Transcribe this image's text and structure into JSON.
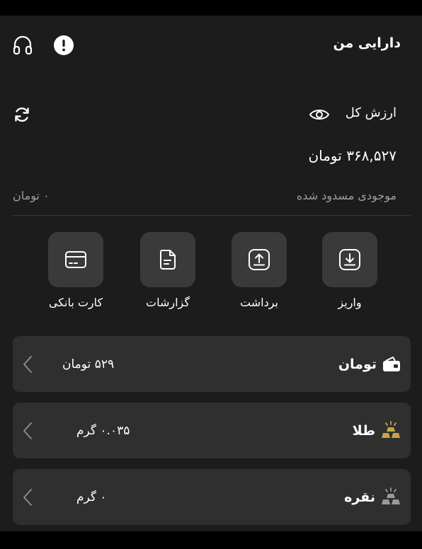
{
  "header": {
    "title": "دارایی من"
  },
  "summary": {
    "total_label": "ارزش کل",
    "total_value": "۳۶۸,۵۲۷ تومان",
    "blocked_label": "موجودی مسدود شده",
    "blocked_value": "۰ تومان"
  },
  "actions": [
    {
      "label": "واریز",
      "icon": "deposit-icon"
    },
    {
      "label": "برداشت",
      "icon": "withdraw-icon"
    },
    {
      "label": "گزارشات",
      "icon": "report-icon"
    },
    {
      "label": "کارت بانکی",
      "icon": "bank-card-icon"
    }
  ],
  "assets": [
    {
      "name": "تومان",
      "amount": "۵۲۹ تومان",
      "icon": "wallet-icon"
    },
    {
      "name": "طلا",
      "amount": "۰.۰۳۵ گرم",
      "icon": "gold-bars-icon"
    },
    {
      "name": "نقره",
      "amount": "۰ گرم",
      "icon": "silver-bars-icon"
    }
  ],
  "colors": {
    "background": "#1c1c1c",
    "card": "#2f2f2f",
    "action_box": "#3a3a3a",
    "muted_text": "#9e9e9e",
    "gold": "#c9a24a",
    "silver": "#9a9a9a"
  }
}
